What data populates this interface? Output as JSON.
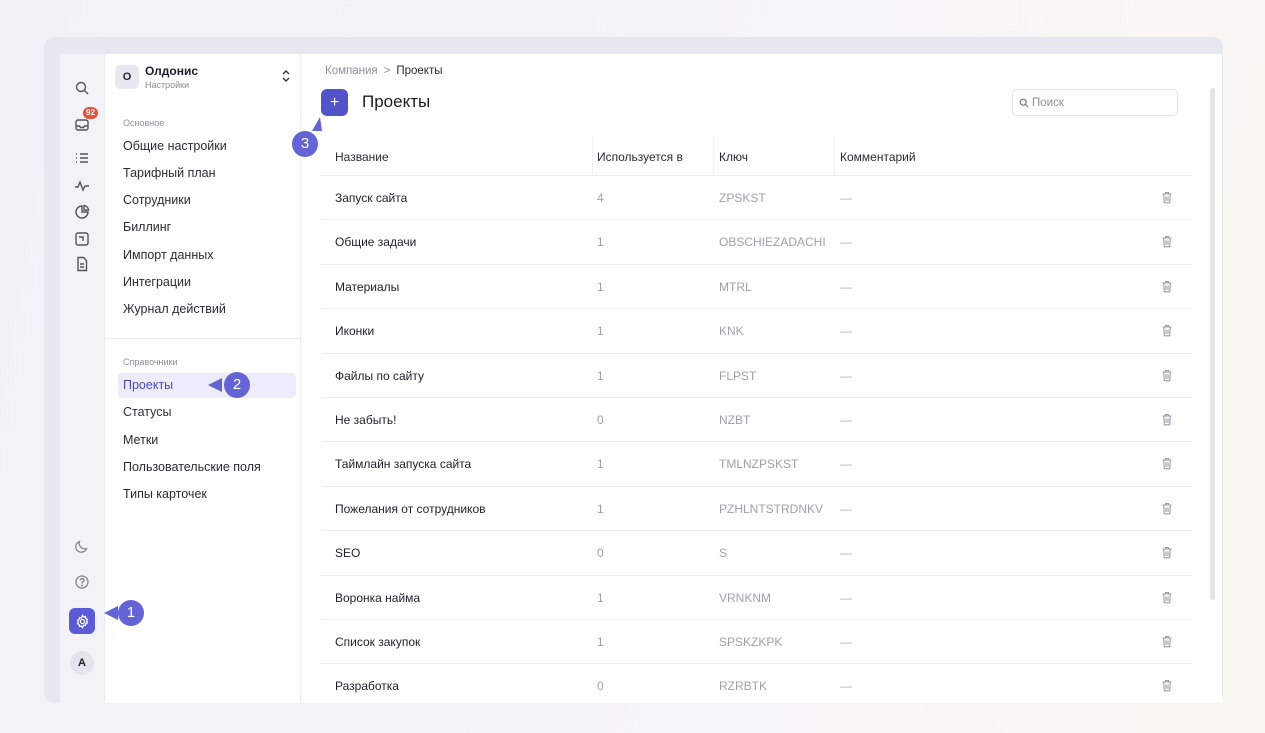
{
  "rail": {
    "inbox_badge": "92",
    "avatar_letter": "A",
    "icons": [
      "search-icon",
      "inbox-icon",
      "list-icon",
      "activity-icon",
      "chart-icon",
      "board-icon",
      "document-icon",
      "moon-icon",
      "help-icon",
      "gear-icon"
    ]
  },
  "org": {
    "avatar_letter": "О",
    "name": "Олдонис",
    "subtitle": "Настройки"
  },
  "sidebar": {
    "section_main": "Основное",
    "main_items": [
      "Общие настройки",
      "Тарифный план",
      "Сотрудники",
      "Биллинг",
      "Импорт данных",
      "Интеграции",
      "Журнал действий"
    ],
    "section_refs": "Справочники",
    "ref_items": [
      "Проекты",
      "Статусы",
      "Метки",
      "Пользовательские поля",
      "Типы карточек"
    ],
    "active": "Проекты"
  },
  "breadcrumb": {
    "parent": "Компания",
    "separator": ">",
    "current": "Проекты"
  },
  "header": {
    "add_label": "+",
    "title": "Проекты"
  },
  "search": {
    "placeholder": "Поиск"
  },
  "table": {
    "columns": [
      "Название",
      "Используется в",
      "Ключ",
      "Комментарий"
    ],
    "rows": [
      {
        "name": "Запуск сайта",
        "used": "4",
        "key": "ZPSKST",
        "comment": "—"
      },
      {
        "name": "Общие задачи",
        "used": "1",
        "key": "OBSCHIEZADACHI",
        "comment": "—"
      },
      {
        "name": "Материалы",
        "used": "1",
        "key": "MTRL",
        "comment": "—"
      },
      {
        "name": "Иконки",
        "used": "1",
        "key": "KNK",
        "comment": "—"
      },
      {
        "name": "Файлы по сайту",
        "used": "1",
        "key": "FLPST",
        "comment": "—"
      },
      {
        "name": "Не забыть!",
        "used": "0",
        "key": "NZBT",
        "comment": "—"
      },
      {
        "name": "Таймлайн запуска сайта",
        "used": "1",
        "key": "TMLNZPSKST",
        "comment": "—"
      },
      {
        "name": "Пожелания от сотрудников",
        "used": "1",
        "key": "PZHLNTSTRDNKV",
        "comment": "—"
      },
      {
        "name": "SEO",
        "used": "0",
        "key": "S",
        "comment": "—"
      },
      {
        "name": "Воронка найма",
        "used": "1",
        "key": "VRNKNM",
        "comment": "—"
      },
      {
        "name": "Список закупок",
        "used": "1",
        "key": "SPSKZKPK",
        "comment": "—"
      },
      {
        "name": "Разработка",
        "used": "0",
        "key": "RZRBTK",
        "comment": "—"
      }
    ]
  },
  "callouts": [
    "1",
    "2",
    "3"
  ],
  "colors": {
    "accent": "#5353c9",
    "callout": "#6464d6",
    "badge": "#e0533d",
    "active_bg": "#ececfa"
  }
}
